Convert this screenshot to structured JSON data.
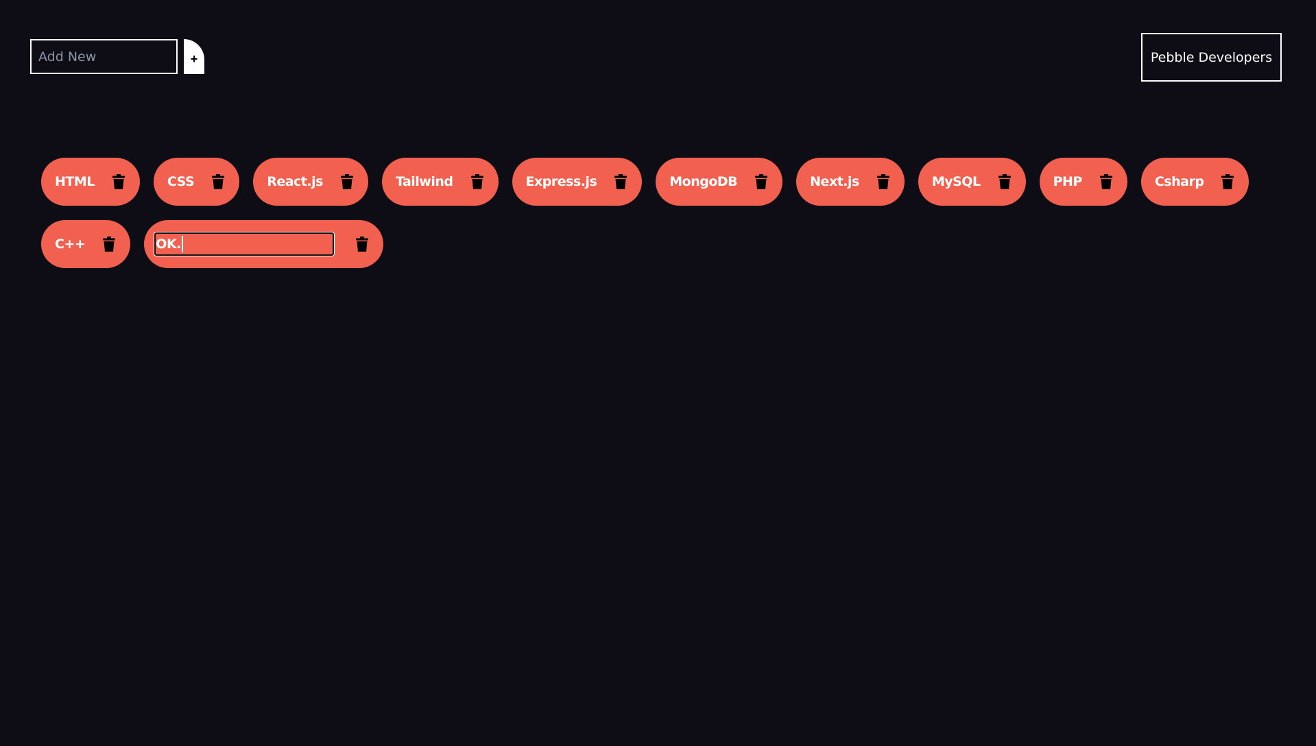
{
  "add_input": {
    "placeholder": "Add New",
    "value": ""
  },
  "add_button": {
    "label": "+"
  },
  "brand_button": {
    "label": "Pebble Developers"
  },
  "colors": {
    "background": "#0e0d16",
    "chip": "#f26150"
  },
  "chips": [
    {
      "label": "HTML"
    },
    {
      "label": "CSS"
    },
    {
      "label": "React.js"
    },
    {
      "label": "Tailwind"
    },
    {
      "label": "Express.js"
    },
    {
      "label": "MongoDB"
    },
    {
      "label": "Next.js"
    },
    {
      "label": "MySQL"
    },
    {
      "label": "PHP"
    },
    {
      "label": "Csharp"
    },
    {
      "label": "C++"
    }
  ],
  "editing_chip": {
    "value": "OK."
  },
  "icons": {
    "delete": "trash-icon"
  }
}
